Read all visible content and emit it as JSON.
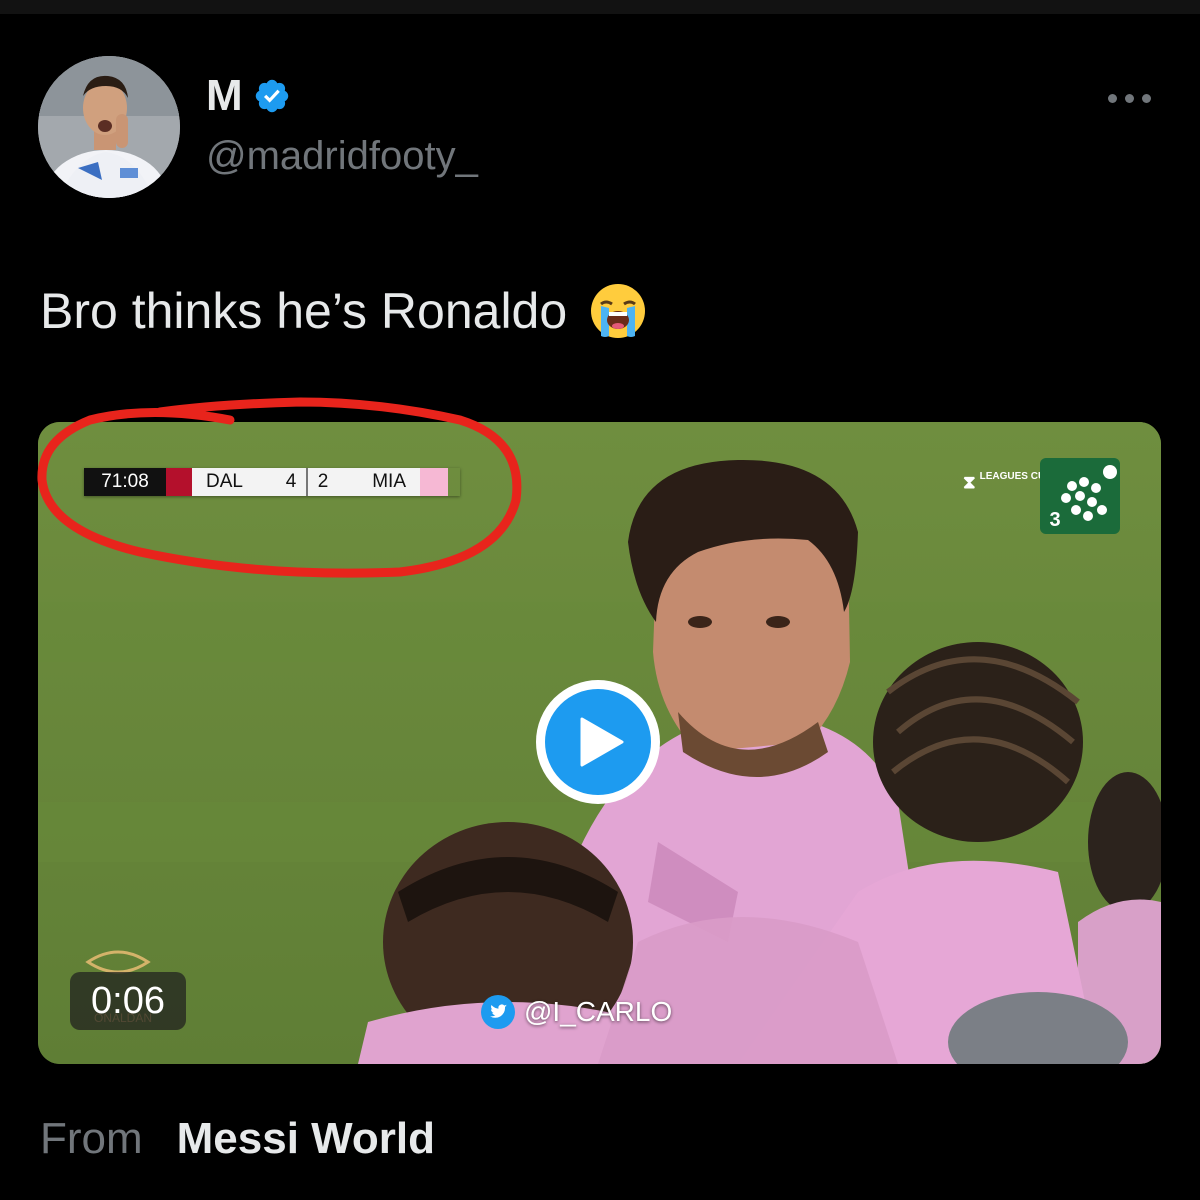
{
  "author": {
    "display_name": "M",
    "handle": "@madridfooty_",
    "verified": true,
    "avatar_icon": "profile-photo-player-icon"
  },
  "tweet": {
    "text": "Bro thinks he’s Ronaldo",
    "emoji": "loudly-crying-face-icon"
  },
  "media": {
    "type": "video",
    "duration": "0:06",
    "scoreboard": {
      "clock": "71:08",
      "home_team": "DAL",
      "home_score": "4",
      "away_score": "2",
      "away_team": "MIA"
    },
    "competition_logo": "LEAGUES CUP",
    "broadcaster_channel": "3",
    "watermark": "@I_CARLO"
  },
  "source": {
    "label": "From",
    "name": "Messi World"
  },
  "colors": {
    "background": "#000000",
    "text_primary": "#e7e9ea",
    "text_secondary": "#71767b",
    "accent_blue": "#1d9bf0",
    "annotation_red": "#e8241c",
    "miami_pink": "#f6b8d4",
    "dallas_red": "#b4102c"
  }
}
